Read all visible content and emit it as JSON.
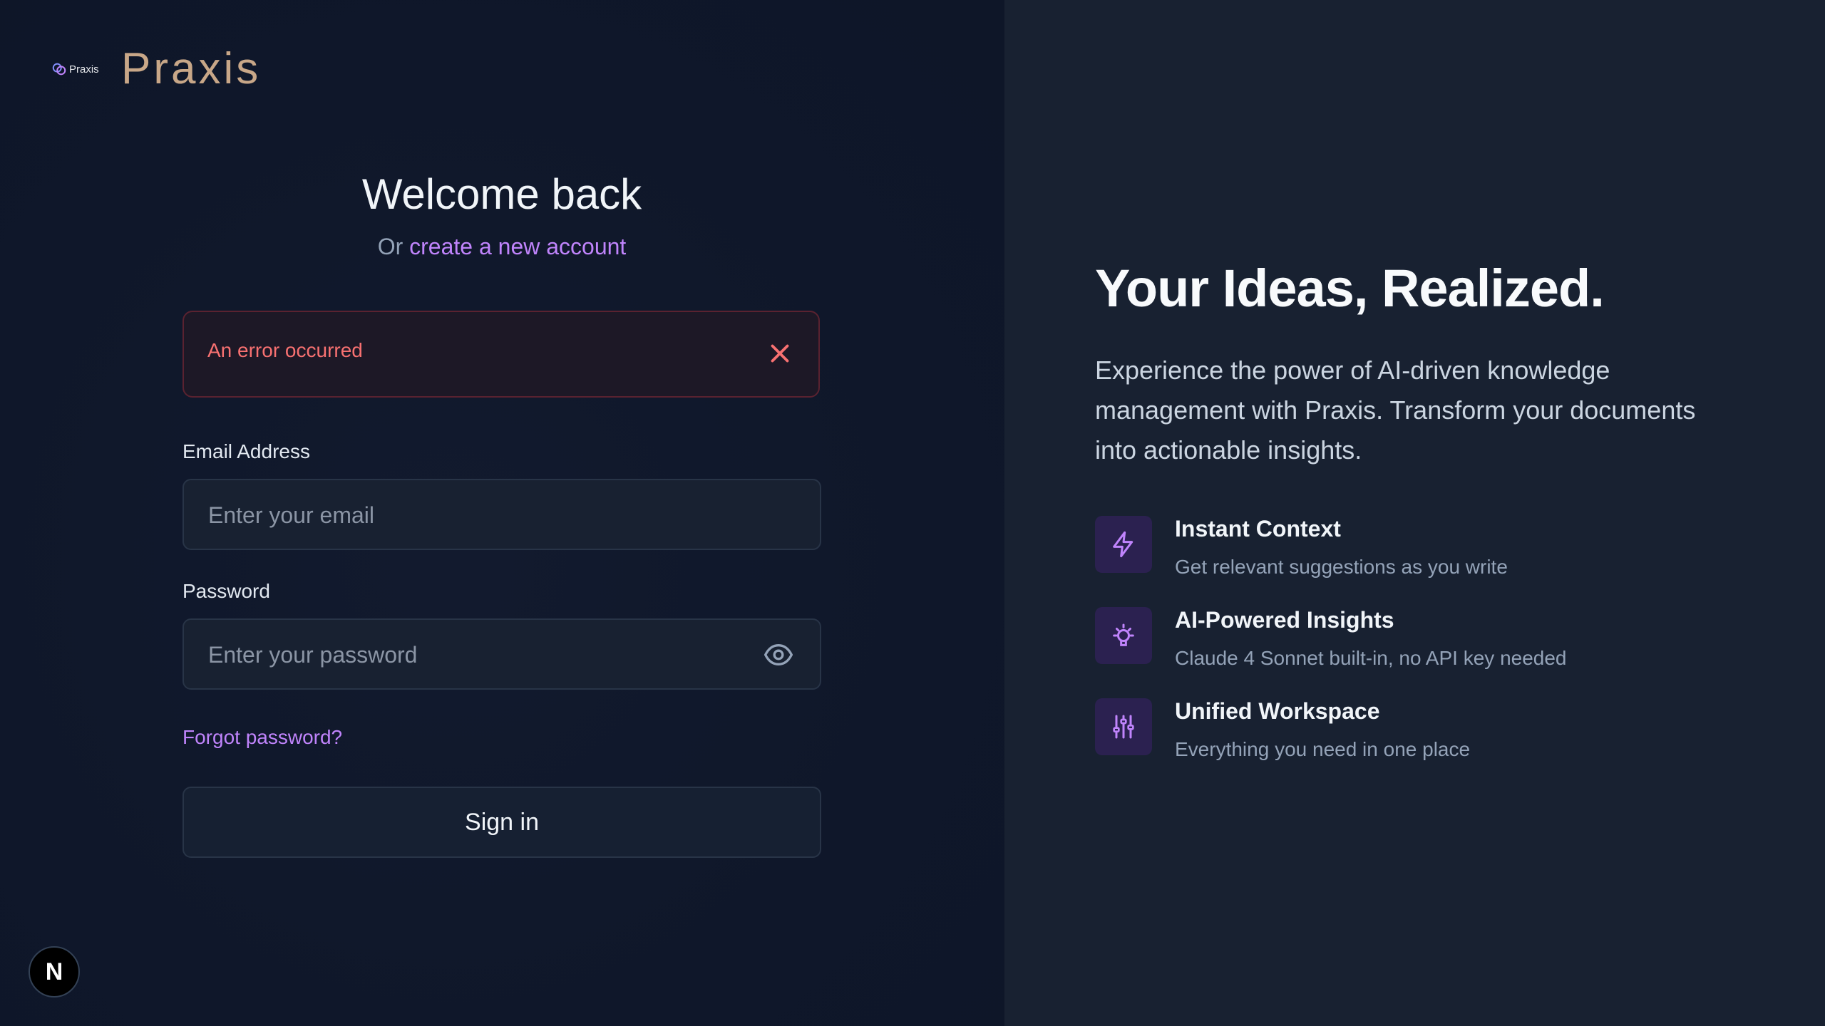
{
  "brand": {
    "logo_text": "Praxis",
    "name": "Praxis"
  },
  "form": {
    "heading": "Welcome back",
    "sub_prefix": "Or",
    "sub_link": "create a new account",
    "error": "An error occurred",
    "email_label": "Email Address",
    "email_placeholder": "Enter your email",
    "password_label": "Password",
    "password_placeholder": "Enter your password",
    "forgot": "Forgot password?",
    "signin": "Sign in"
  },
  "badge": {
    "letter": "N"
  },
  "hero": {
    "title": "Your Ideas, Realized.",
    "description": "Experience the power of AI-driven knowledge management with Praxis. Transform your documents into actionable insights.",
    "features": [
      {
        "icon": "lightning-icon",
        "title": "Instant Context",
        "desc": "Get relevant suggestions as you write"
      },
      {
        "icon": "lightbulb-icon",
        "title": "AI-Powered Insights",
        "desc": "Claude 4 Sonnet built-in, no API key needed"
      },
      {
        "icon": "sliders-icon",
        "title": "Unified Workspace",
        "desc": "Everything you need in one place"
      }
    ]
  },
  "colors": {
    "accent": "#c084fc",
    "error": "#f87171",
    "brand": "#c8a788"
  }
}
